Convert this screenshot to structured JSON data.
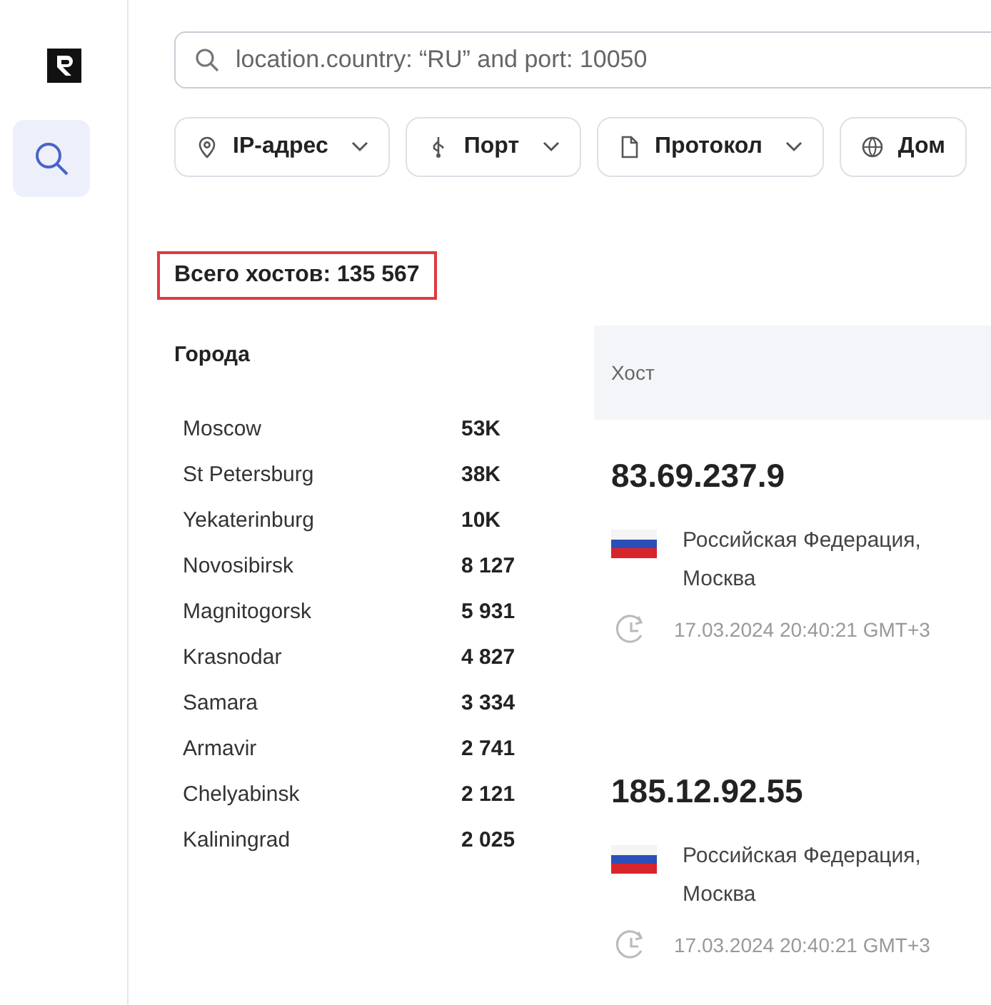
{
  "search": {
    "value": "location.country: “RU” and port: 10050"
  },
  "filters": [
    {
      "kind": "pin",
      "label": "IP-адрес",
      "dropdown": true
    },
    {
      "kind": "usb",
      "label": "Порт",
      "dropdown": true
    },
    {
      "kind": "file",
      "label": "Протокол",
      "dropdown": true
    },
    {
      "kind": "globe",
      "label": "Дом",
      "dropdown": false
    }
  ],
  "total": {
    "text": "Всего хостов: 135 567",
    "highlighted": true
  },
  "cities": {
    "title": "Города",
    "rows": [
      {
        "name": "Moscow",
        "count": "53K"
      },
      {
        "name": "St Petersburg",
        "count": "38K"
      },
      {
        "name": "Yekaterinburg",
        "count": "10K"
      },
      {
        "name": "Novosibirsk",
        "count": "8 127"
      },
      {
        "name": "Magnitogorsk",
        "count": "5 931"
      },
      {
        "name": "Krasnodar",
        "count": "4 827"
      },
      {
        "name": "Samara",
        "count": "3 334"
      },
      {
        "name": "Armavir",
        "count": "2 741"
      },
      {
        "name": "Chelyabinsk",
        "count": "2 121"
      },
      {
        "name": "Kaliningrad",
        "count": "2 025"
      }
    ]
  },
  "table": {
    "columns": [
      "Хост"
    ],
    "hosts": [
      {
        "ip": "83.69.237.9",
        "location": "Российская Федерация, Москва",
        "time": "17.03.2024 20:40:21 GMT+3"
      },
      {
        "ip": "185.12.92.55",
        "location": "Российская Федерация, Москва",
        "time": "17.03.2024 20:40:21 GMT+3"
      }
    ]
  }
}
